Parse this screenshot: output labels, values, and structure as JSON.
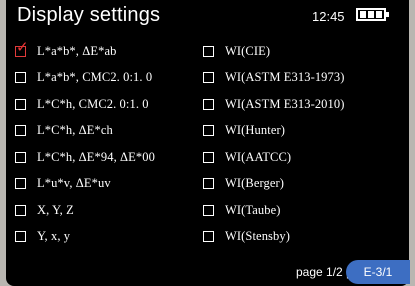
{
  "header": {
    "title": "Display settings",
    "time": "12:45",
    "battery_icon": "battery-full-icon"
  },
  "left_items": [
    {
      "label": "L*a*b*, ΔE*ab",
      "checked": true
    },
    {
      "label": "L*a*b*, CMC2. 0:1. 0",
      "checked": false
    },
    {
      "label": "L*C*h, CMC2. 0:1. 0",
      "checked": false
    },
    {
      "label": "L*C*h, ΔE*ch",
      "checked": false
    },
    {
      "label": "L*C*h, ΔE*94, ΔE*00",
      "checked": false
    },
    {
      "label": "L*u*v, ΔE*uv",
      "checked": false
    },
    {
      "label": "X, Y, Z",
      "checked": false
    },
    {
      "label": "Y, x, y",
      "checked": false
    }
  ],
  "right_items": [
    {
      "label": "WI(CIE)",
      "checked": false
    },
    {
      "label": "WI(ASTM E313-1973)",
      "checked": false
    },
    {
      "label": "WI(ASTM E313-2010)",
      "checked": false
    },
    {
      "label": "WI(Hunter)",
      "checked": false
    },
    {
      "label": "WI(AATCC)",
      "checked": false
    },
    {
      "label": "WI(Berger)",
      "checked": false
    },
    {
      "label": "WI(Taube)",
      "checked": false
    },
    {
      "label": "WI(Stensby)",
      "checked": false
    }
  ],
  "footer": {
    "page": "page 1/2",
    "page_suffix": "p",
    "badge": "E-3/1"
  },
  "colors": {
    "background": "#000000",
    "check_red": "#e03a3a",
    "badge_blue": "#3d6ec2"
  }
}
